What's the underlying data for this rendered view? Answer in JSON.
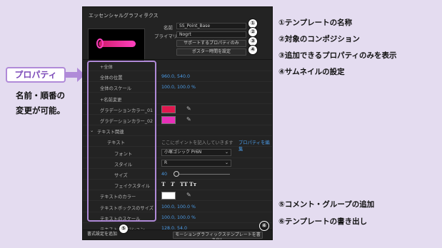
{
  "callout": {
    "label": "プロパティ",
    "desc_line1": "名前・順番の",
    "desc_line2": "変更が可能。"
  },
  "panel": {
    "title": "エッセンシャルグラフィックス",
    "menu_glyph": "≡",
    "name_label": "名前",
    "name_value": "SS_Point_Base",
    "primary_label": "プライマリ",
    "primary_value": "Nogrt",
    "solo_button": "サポートするプロパティのみ",
    "poster_button": "ポスター時間を設定",
    "rows": [
      {
        "label": "+全体",
        "type": "header"
      },
      {
        "label": "全体の位置",
        "type": "value",
        "value": "960.0, 540.0"
      },
      {
        "label": "全体のスケール",
        "type": "value",
        "value": "100.0, 100.0 %"
      },
      {
        "label": "+名前変更",
        "type": "header"
      },
      {
        "label": "グラデーションカラー_01",
        "type": "color",
        "color": "#e0184f"
      },
      {
        "label": "グラデーションカラー_02",
        "type": "color",
        "color": "#e82fb8"
      },
      {
        "label": "テキスト関連",
        "type": "group"
      },
      {
        "label": "テキスト",
        "type": "text",
        "value": "ここにポイントを記入していきます",
        "link": "プロパティを編集"
      },
      {
        "label": "フォント",
        "type": "select",
        "value": "小塚ゴシック Pr6N"
      },
      {
        "label": "スタイル",
        "type": "select",
        "value": "R"
      },
      {
        "label": "サイズ",
        "type": "slider",
        "value": "40"
      },
      {
        "label": "フェイクスタイル",
        "type": "fstyle"
      },
      {
        "label": "テキストのカラー",
        "type": "color",
        "color": "#ffffff"
      },
      {
        "label": "テキストボックスのサイズ",
        "type": "value",
        "value": "100.0, 100.0 %"
      },
      {
        "label": "テキストのスケール",
        "type": "value",
        "value": "100.0, 100.0 %"
      },
      {
        "label": "テキストのポジション",
        "type": "value",
        "value": "128.0, 54.0"
      }
    ],
    "fstyle_glyphs": [
      "T",
      "T",
      "TT",
      "Tт"
    ],
    "add_format_button": "書式設定を追加",
    "export_button": "モーショングラフィックステンプレートを書き出し"
  },
  "markers": [
    "①",
    "②",
    "③",
    "④",
    "⑤",
    "⑥"
  ],
  "legend": [
    "①テンプレートの名称",
    "②対象のコンポジション",
    "③追加できるプロパティのみを表示",
    "④サムネイルの設定",
    "⑤コメント・グループの追加",
    "⑥テンプレートの書き出し"
  ],
  "colors": {
    "accent": "#b08ad8",
    "value_blue": "#4b9ce8",
    "background": "#e4dcf0"
  }
}
